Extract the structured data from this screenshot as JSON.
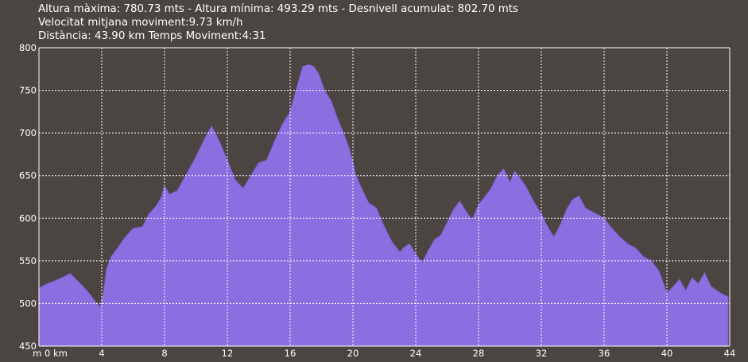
{
  "stats": {
    "line1": "Altura màxima: 780.73 mts - Altura mínima: 493.29 mts - Desnivell acumulat: 802.70 mts",
    "line2": "Velocitat mitjana moviment:9.73 km/h",
    "line3": "Distància: 43.90 km  Temps Moviment:4:31"
  },
  "colors": {
    "background": "#4b4541",
    "fill": "#8b6fe0",
    "grid": "#ffffff",
    "text": "#ffffff"
  },
  "chart_data": {
    "type": "area",
    "title": "",
    "xlabel": "",
    "ylabel": "",
    "x_unit_label": "m 0 km",
    "xlim": [
      0,
      44
    ],
    "ylim": [
      450,
      800
    ],
    "x_ticks": [
      0,
      4,
      8,
      12,
      16,
      20,
      24,
      28,
      32,
      36,
      40,
      44
    ],
    "x_tick_labels": [
      "m 0 km",
      "4",
      "8",
      "12",
      "16",
      "20",
      "24",
      "28",
      "32",
      "36",
      "40",
      "44"
    ],
    "y_ticks": [
      450,
      500,
      550,
      600,
      650,
      700,
      750,
      800
    ],
    "grid": true,
    "series": [
      {
        "x": [
          0,
          0.5,
          1.2,
          2,
          2.8,
          3.2,
          3.6,
          3.9,
          4.1,
          4.3,
          4.6,
          5.0,
          5.5,
          6.0,
          6.6,
          7.0,
          7.5,
          7.8,
          8.0,
          8.3,
          8.8,
          9.4,
          10.0,
          10.6,
          11.0,
          11.5,
          12.0,
          12.5,
          13.0,
          13.5,
          14.0,
          14.5,
          15.0,
          15.5,
          16.0,
          16.4,
          16.8,
          17.2,
          17.5,
          17.8,
          18.2,
          18.6,
          19.0,
          19.4,
          19.8,
          20.2,
          20.6,
          21.0,
          21.5,
          22.0,
          22.5,
          23.0,
          23.2,
          23.6,
          24.0,
          24.4,
          24.8,
          25.2,
          25.6,
          26.0,
          26.4,
          26.8,
          27.2,
          27.6,
          28.0,
          28.4,
          28.8,
          29.2,
          29.6,
          30.0,
          30.3,
          30.6,
          31.0,
          31.5,
          32.0,
          32.4,
          32.8,
          33.2,
          33.6,
          34.0,
          34.4,
          34.8,
          35.2,
          35.6,
          36.0,
          36.5,
          37.0,
          37.5,
          38.0,
          38.5,
          39.0,
          39.5,
          40.0,
          40.4,
          40.8,
          41.2,
          41.6,
          42.0,
          42.4,
          42.8,
          43.2,
          43.6,
          43.9
        ],
        "y": [
          518,
          523,
          528,
          535,
          520,
          512,
          502,
          496,
          512,
          540,
          555,
          565,
          578,
          588,
          590,
          605,
          615,
          625,
          638,
          628,
          632,
          652,
          672,
          695,
          708,
          690,
          668,
          645,
          635,
          650,
          665,
          668,
          690,
          710,
          725,
          752,
          778,
          780,
          778,
          770,
          750,
          738,
          718,
          700,
          680,
          650,
          633,
          618,
          612,
          590,
          572,
          560,
          565,
          570,
          558,
          548,
          562,
          575,
          580,
          595,
          610,
          620,
          608,
          598,
          616,
          625,
          635,
          650,
          658,
          642,
          655,
          648,
          638,
          620,
          605,
          590,
          578,
          592,
          610,
          622,
          626,
          612,
          608,
          604,
          600,
          588,
          578,
          570,
          565,
          555,
          550,
          538,
          512,
          520,
          528,
          515,
          530,
          523,
          536,
          520,
          515,
          510,
          508
        ]
      }
    ]
  }
}
